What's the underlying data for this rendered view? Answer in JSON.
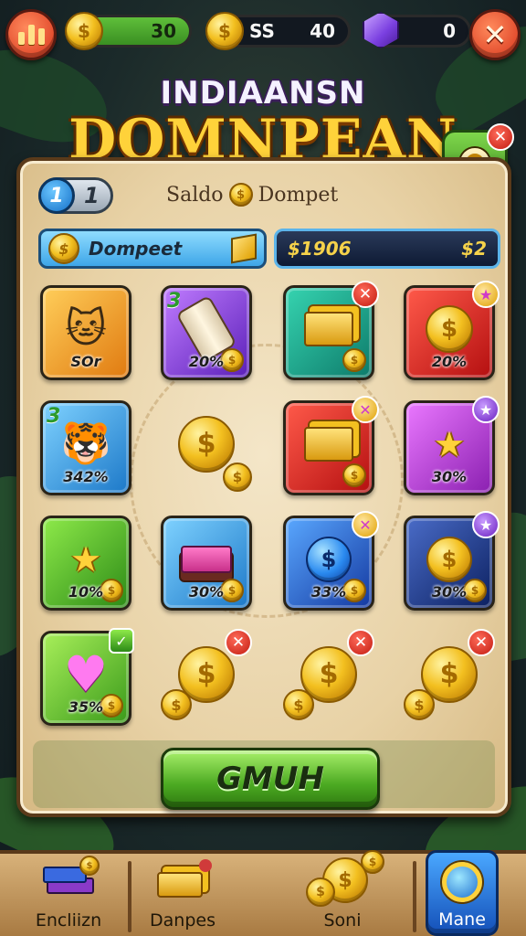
{
  "topbar": {
    "coins_value": "30",
    "currency_label": "SS",
    "currency_value": "40",
    "gems_value": "0"
  },
  "title": {
    "line1": "INDIAANSN",
    "line2": "DOMNPEAN"
  },
  "panel": {
    "page_number": "1",
    "page_total": "1",
    "subtitle_left": "Saldo",
    "subtitle_right": "Dompet",
    "wallet_label": "Dompeet",
    "balance_left": "$1906",
    "balance_right": "$2",
    "primary_button": "GMUH"
  },
  "items": [
    {
      "label": "SOr",
      "bg": "orange",
      "art": "cat"
    },
    {
      "label": "20%",
      "bg": "purple",
      "art": "scroll",
      "badge": "3"
    },
    {
      "label": "",
      "bg": "teal",
      "art": "gold"
    },
    {
      "label": "20%",
      "bg": "red",
      "art": "coin"
    },
    {
      "label": "342%",
      "bg": "sky",
      "art": "cat",
      "badge": "3"
    },
    {
      "label": "",
      "bg": "none",
      "art": "coin"
    },
    {
      "label": "",
      "bg": "red",
      "art": "gold"
    },
    {
      "label": "30%",
      "bg": "magenta",
      "art": "star"
    },
    {
      "label": "10%",
      "bg": "green",
      "art": "star"
    },
    {
      "label": "30%",
      "bg": "sky",
      "art": "book"
    },
    {
      "label": "33%",
      "bg": "blue",
      "art": "coin"
    },
    {
      "label": "30%",
      "bg": "navy",
      "art": "coin"
    },
    {
      "label": "35%",
      "bg": "lime",
      "art": "heart"
    },
    {
      "label": "",
      "bg": "none",
      "art": "coin"
    },
    {
      "label": "",
      "bg": "none",
      "art": "coin"
    },
    {
      "label": "",
      "bg": "none",
      "art": "coin"
    }
  ],
  "bottom_nav": [
    {
      "label": "Encliizn"
    },
    {
      "label": "Danpes"
    },
    {
      "label": "Soni"
    },
    {
      "label": "Mane"
    }
  ],
  "colors": {
    "primary_green": "#4caa22",
    "gold": "#f3c020",
    "panel_parchment": "#e8d2a6",
    "close_red": "#d7341b"
  }
}
